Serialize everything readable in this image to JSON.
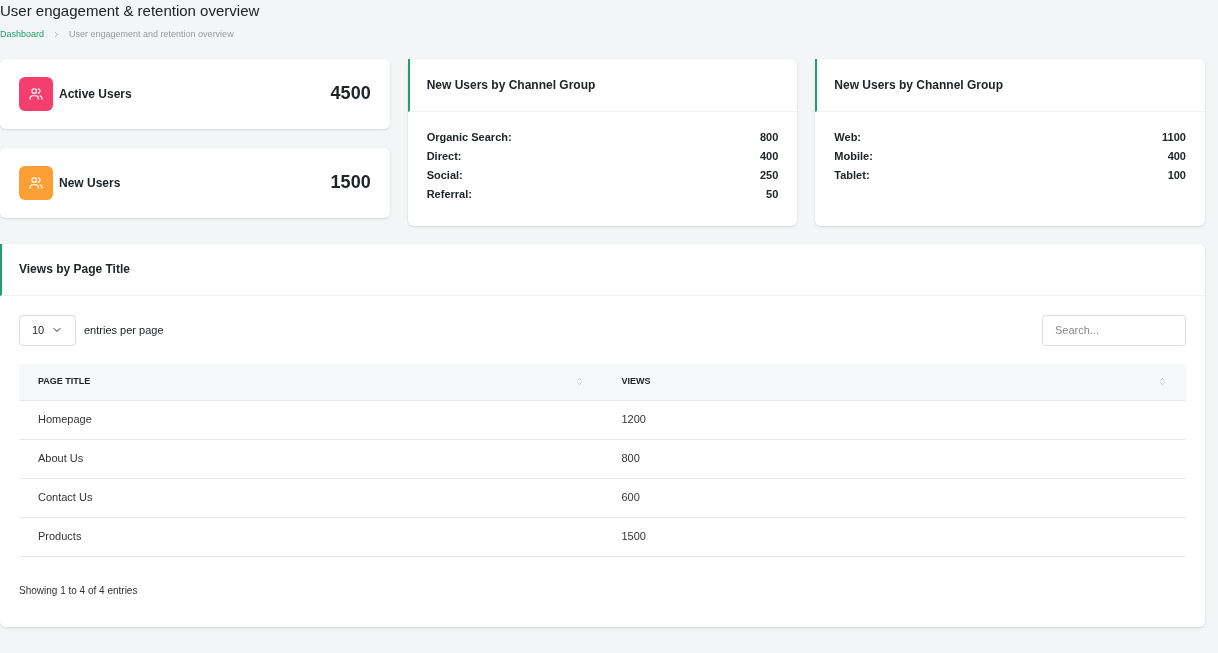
{
  "page_title": "User engagement & retention overview",
  "breadcrumb": {
    "link": "Dashboard",
    "current": "User engagement and retention overview"
  },
  "stats": [
    {
      "label": "Active Users",
      "value": "4500",
      "color": "#f43f6e"
    },
    {
      "label": "New Users",
      "value": "1500",
      "color": "#fb9f35"
    }
  ],
  "channel_cards": [
    {
      "title": "New Users by Channel Group",
      "rows": [
        {
          "label": "Organic Search:",
          "value": "800"
        },
        {
          "label": "Direct:",
          "value": "400"
        },
        {
          "label": "Social:",
          "value": "250"
        },
        {
          "label": "Referral:",
          "value": "50"
        }
      ]
    },
    {
      "title": "New Users by Channel Group",
      "rows": [
        {
          "label": "Web:",
          "value": "1100"
        },
        {
          "label": "Mobile:",
          "value": "400"
        },
        {
          "label": "Tablet:",
          "value": "100"
        }
      ]
    }
  ],
  "table_card": {
    "title": "Views by Page Title",
    "page_size": "10",
    "page_size_label": "entries per page",
    "search": {
      "placeholder": "Search..."
    },
    "columns": [
      "PAGE TITLE",
      "VIEWS"
    ],
    "rows": [
      [
        "Homepage",
        "1200"
      ],
      [
        "About Us",
        "800"
      ],
      [
        "Contact Us",
        "600"
      ],
      [
        "Products",
        "1500"
      ]
    ],
    "footer": "Showing 1 to 4 of 4 entries"
  }
}
